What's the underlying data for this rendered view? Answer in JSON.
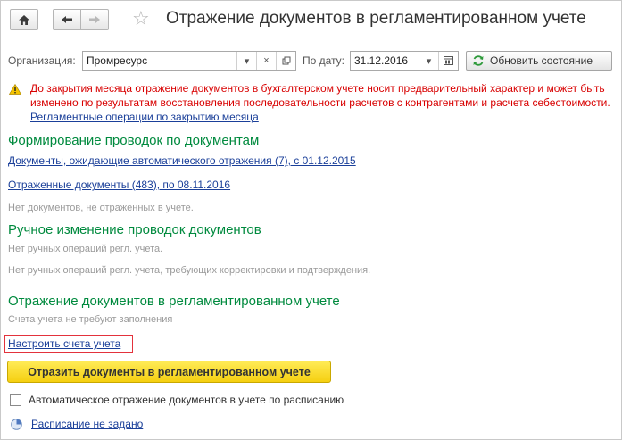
{
  "header": {
    "title": "Отражение документов в регламентированном учете"
  },
  "filters": {
    "org_label": "Организация:",
    "org_value": "Промресурс",
    "date_label": "По дату:",
    "date_value": "31.12.2016",
    "refresh_label": "Обновить состояние"
  },
  "warning": {
    "text": "До закрытия месяца отражение документов в бухгалтерском учете носит предварительный характер и может быть изменено по результатам восстановления последовательности расчетов с контрагентами и расчета себестоимости.",
    "link": "Регламентные операции по закрытию месяца"
  },
  "posting_section": {
    "title": "Формирование проводок по документам",
    "pending_link": "Документы, ожидающие автоматического отражения (7), с 01.12.2015",
    "posted_link": "Отраженные документы (483), по 08.11.2016",
    "not_posted_text": "Нет документов, не отраженных в учете."
  },
  "manual_section": {
    "title": "Ручное изменение проводок документов",
    "no_ops_text": "Нет ручных операций регл. учета.",
    "no_ops_confirm_text": "Нет ручных операций регл. учета, требующих корректировки и подтверждения."
  },
  "reflection_section": {
    "title": "Отражение документов в регламентированном учете",
    "accounts_text": "Счета учета не требуют заполнения",
    "configure_link": "Настроить счета учета",
    "main_button": "Отразить документы в регламентированном учете",
    "auto_checkbox_label": "Автоматическое отражение документов в учете по расписанию",
    "auto_checkbox_checked": false,
    "schedule_link": "Расписание не задано"
  },
  "colors": {
    "accent_green": "#008a3e",
    "warning_red": "#d80000",
    "link_blue": "#1a3f99",
    "button_yellow": "#f5cf10"
  }
}
